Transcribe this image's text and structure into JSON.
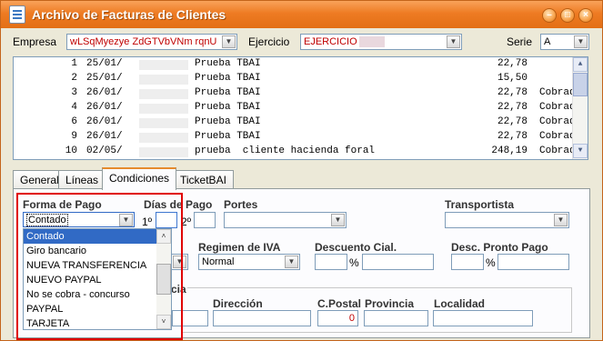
{
  "window": {
    "title": "Archivo de Facturas de Clientes",
    "buttons": [
      "minimize",
      "restore",
      "close"
    ]
  },
  "header": {
    "empresa_label": "Empresa",
    "empresa_value": "wLSqMyezye ZdGTVbVNm rqnU",
    "ejercicio_label": "Ejercicio",
    "ejercicio_value": "EJERCICIO",
    "serie_label": "Serie",
    "serie_value": "A"
  },
  "invoices": [
    {
      "num": "1",
      "date": "25/01/",
      "client": "Prueba TBAI",
      "amount": "22,78",
      "status": ""
    },
    {
      "num": "2",
      "date": "25/01/",
      "client": "Prueba TBAI",
      "amount": "15,50",
      "status": ""
    },
    {
      "num": "3",
      "date": "26/01/",
      "client": "Prueba TBAI",
      "amount": "22,78",
      "status": "Cobrada"
    },
    {
      "num": "4",
      "date": "26/01/",
      "client": "Prueba TBAI",
      "amount": "22,78",
      "status": "Cobrada"
    },
    {
      "num": "6",
      "date": "26/01/",
      "client": "Prueba TBAI",
      "amount": "22,78",
      "status": "Cobrada"
    },
    {
      "num": "9",
      "date": "26/01/",
      "client": "Prueba TBAI",
      "amount": "22,78",
      "status": "Cobrada"
    },
    {
      "num": "10",
      "date": "02/05/",
      "client": "prueba  cliente hacienda foral",
      "amount": "248,19",
      "status": "Cobrada"
    }
  ],
  "tabs": [
    {
      "label": "General"
    },
    {
      "label": "Líneas"
    },
    {
      "label": "Condiciones"
    },
    {
      "label": "TicketBAI"
    }
  ],
  "conditions": {
    "forma_pago_label": "Forma de Pago",
    "forma_pago_value": "Contado",
    "dias_pago_label": "Días de Pago",
    "dia1_label": "1º",
    "dia2_label": "2º",
    "portes_label": "Portes",
    "transportista_label": "Transportista",
    "regimen_iva_label": "Regimen de IVA",
    "regimen_iva_value": "Normal",
    "descuento_label": "Descuento Cial.",
    "percent_sign": "%",
    "pronto_pago_label": "Desc. Pronto Pago",
    "group_label_fragment": "cia",
    "direccion_label": "Dirección",
    "cpostal_label": "C.Postal",
    "cpostal_value": "0",
    "provincia_label": "Provincia",
    "localidad_label": "Localidad"
  },
  "payment_options": [
    "Contado",
    "Giro bancario",
    "NUEVA TRANSFERENCIA",
    "NUEVO PAYPAL",
    "No se cobra - concurso",
    "PAYPAL",
    "TARJETA"
  ],
  "colors": {
    "titlebar": "#ee7b23",
    "selection": "#316ac5",
    "highlight_frame": "#e00000",
    "active_tab_accent": "#e68b2c"
  }
}
